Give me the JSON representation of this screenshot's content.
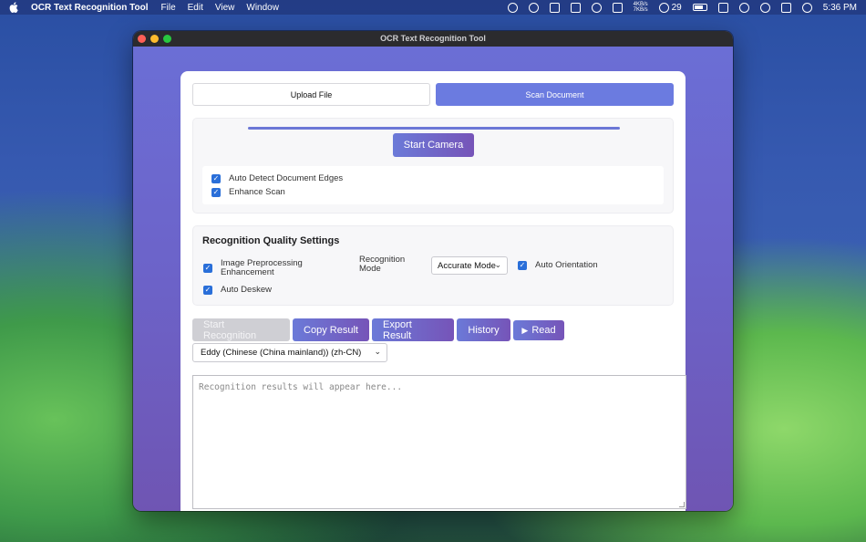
{
  "menubar": {
    "app_name": "OCR Text Recognition Tool",
    "menus": [
      "File",
      "Edit",
      "View",
      "Window"
    ],
    "net_up": "4KB/s",
    "net_down": "7KB/s",
    "wechat_count": "29",
    "clock": "5:36 PM"
  },
  "window": {
    "title": "OCR Text Recognition Tool"
  },
  "tabs": {
    "upload_label": "Upload File",
    "scan_label": "Scan Document",
    "active": "scan"
  },
  "scan": {
    "progress": 1.0,
    "camera_button_label": "Start Camera",
    "options": [
      {
        "label": "Auto Detect Document Edges",
        "checked": true
      },
      {
        "label": "Enhance Scan",
        "checked": true
      }
    ]
  },
  "quality": {
    "title": "Recognition Quality Settings",
    "preprocessing_line1": "Image Preprocessing",
    "preprocessing_line2": "Enhancement",
    "mode_label_line1": "Recognition",
    "mode_label_line2": "Mode",
    "mode_value": "Accurate Mode",
    "auto_orientation_label": "Auto Orientation",
    "auto_deskew_label": "Auto Deskew"
  },
  "actions": {
    "start_label": "Start Recognition",
    "copy_label": "Copy Result",
    "export_label": "Export Result",
    "history_label": "History",
    "read_label": "Read"
  },
  "voice": {
    "selected": "Eddy (Chinese (China mainland)) (zh-CN)"
  },
  "result": {
    "placeholder": "Recognition results will appear here..."
  },
  "colors": {
    "accent": "#6b7be0",
    "gradient_start": "#6b7ad8",
    "gradient_end": "#7654b8",
    "checkbox": "#2a6fd9"
  }
}
